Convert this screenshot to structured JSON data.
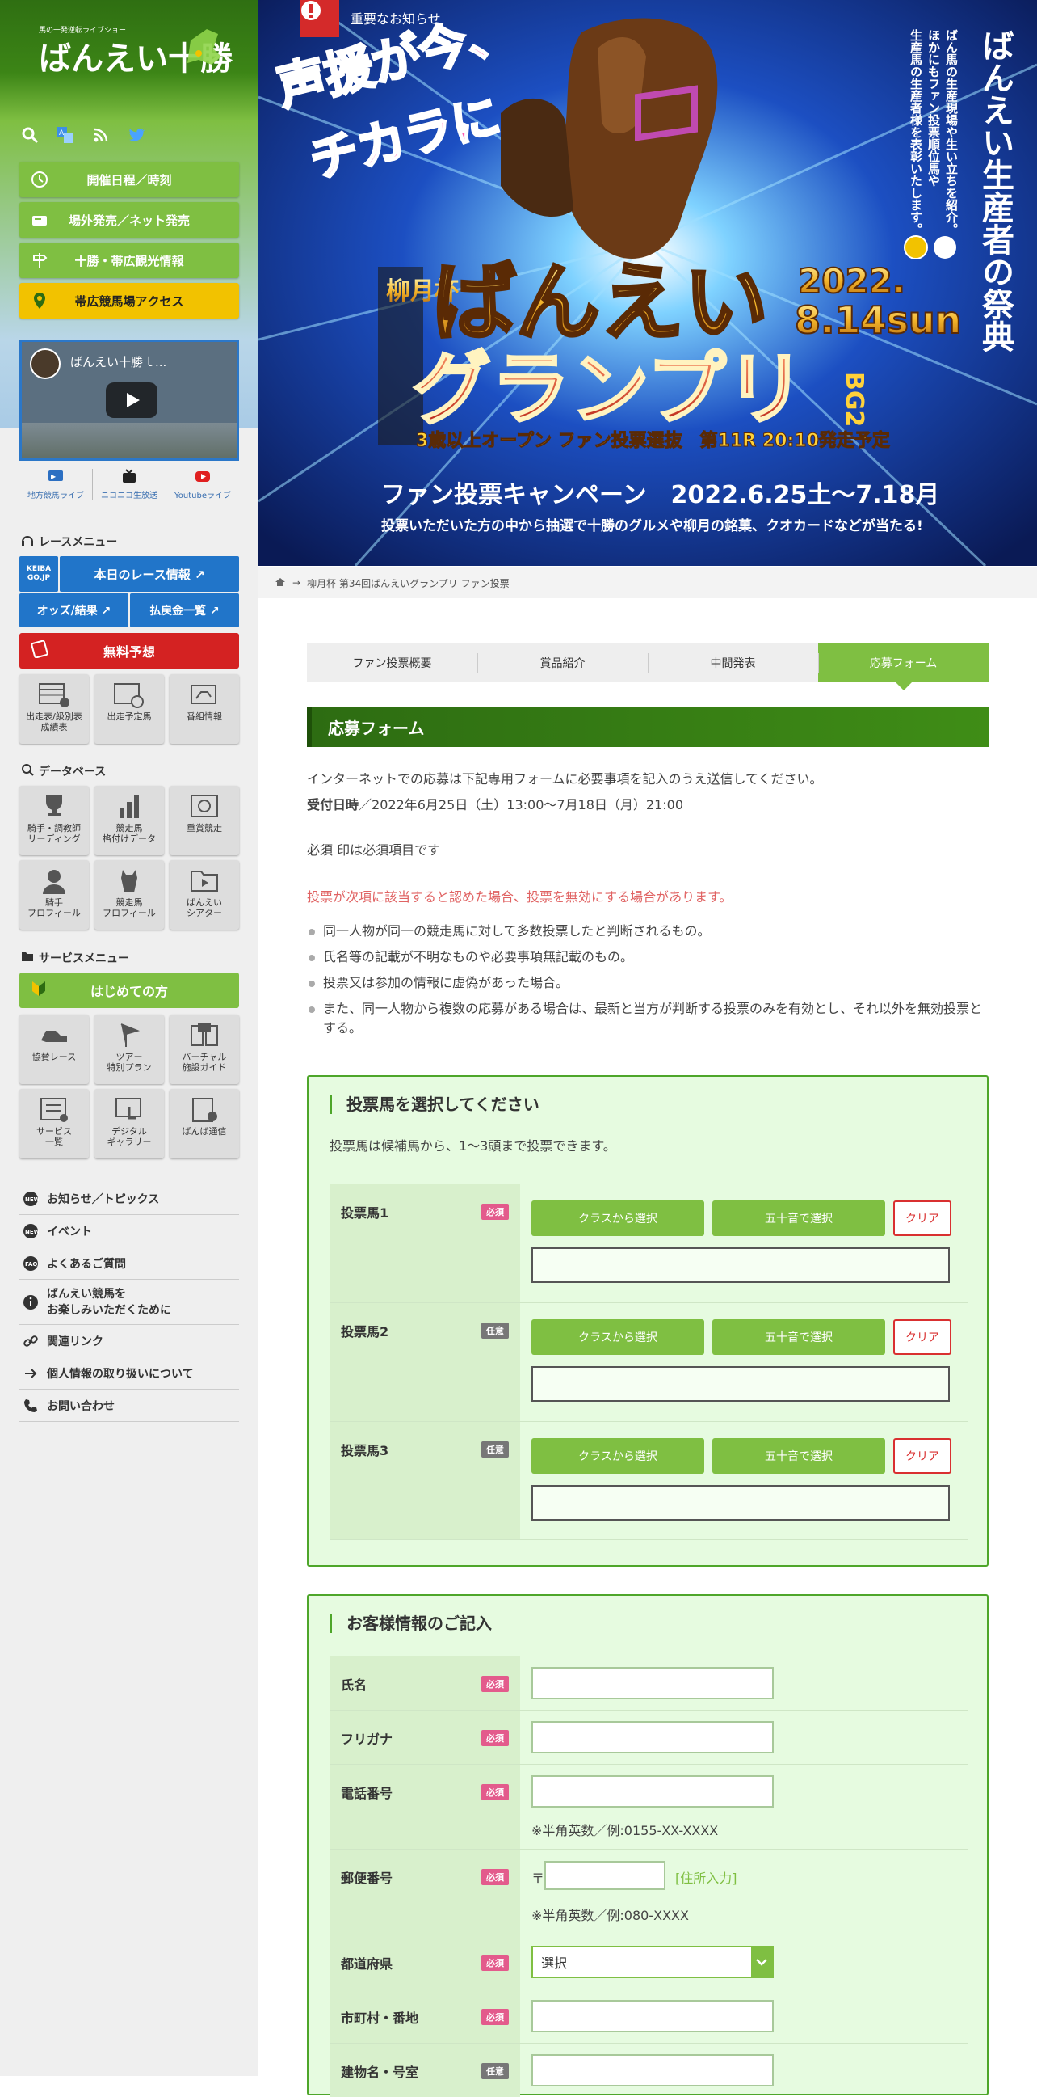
{
  "site": {
    "logo_text": "ばんえい十勝",
    "logo_sub": "馬の一発逆転ライブショー"
  },
  "sidebar": {
    "main_buttons": [
      {
        "label": "開催日程／時刻",
        "icon": "clock-icon"
      },
      {
        "label": "場外発売／ネット発売",
        "icon": "ticket-icon"
      },
      {
        "label": "十勝・帯広観光情報",
        "icon": "signpost-icon"
      },
      {
        "label": "帯広競馬場アクセス",
        "icon": "map-pin-icon"
      }
    ],
    "video": {
      "title": "ばんえい十勝ｌ..."
    },
    "live_links": [
      "地方競馬ライブ",
      "ニコニコ生放送",
      "Youtubeライブ"
    ],
    "race_menu": {
      "heading": "レースメニュー",
      "keiba_label": "KEIBA GO.JP",
      "today_race": "本日のレース情報 ↗",
      "odds": "オッズ/結果 ↗",
      "payout": "払戻金一覧 ↗",
      "free_prediction": "無料予想",
      "tiles": [
        "出走表/級別表\n成績表",
        "出走予定馬",
        "番組情報"
      ]
    },
    "database": {
      "heading": "データベース",
      "tiles": [
        "騎手・調教師\nリーディング",
        "競走馬\n格付けデータ",
        "重賞競走",
        "騎手\nプロフィール",
        "競走馬\nプロフィール",
        "ばんえい\nシアター"
      ]
    },
    "service_menu": {
      "heading": "サービスメニュー",
      "first_time": "はじめての方",
      "tiles": [
        "協賛レース",
        "ツアー\n特別プラン",
        "バーチャル\n施設ガイド",
        "サービス\n一覧",
        "デジタル\nギャラリー",
        "ばんば通信"
      ]
    },
    "links": [
      {
        "label": "お知らせ／トピックス",
        "icon": "new-icon"
      },
      {
        "label": "イベント",
        "icon": "new-icon"
      },
      {
        "label": "よくあるご質問",
        "icon": "faq-icon"
      },
      {
        "label": "ばんえい競馬を\nお楽しみいただくために",
        "icon": "info-icon"
      },
      {
        "label": "関連リンク",
        "icon": "link-icon"
      },
      {
        "label": "個人情報の取り扱いについて",
        "icon": "arrow-icon"
      },
      {
        "label": "お問い合わせ",
        "icon": "phone-icon"
      }
    ]
  },
  "hero": {
    "notice": "重要なお知らせ",
    "catch": "声援が今、\nチカラに",
    "right_title": "ばんえい生産者の祭典",
    "right_sub": "ばん馬の生産現場や生い立ちを紹介。\nほかにもファン投票順位馬や\n生産馬の生産者様を表彰いたします。",
    "cup_name": "柳月杯 第34回",
    "event_name": "ばんえいグランプリ",
    "grade": "BG2",
    "date": "2022.\n8.14sun",
    "race_info": "3歳以上オープン ファン投票選抜　第11R 20:10発走予定",
    "campaign": "ファン投票キャンペーン　2022.6.25土〜7.18月",
    "campaign_sub": "投票いただいた方の中から抽選で十勝のグルメや柳月の銘菓、クオカードなどが当たる!"
  },
  "breadcrumb": [
    "ホーム",
    "柳月杯 第34回ばんえいグランプリ ファン投票"
  ],
  "tabs": [
    "ファン投票概要",
    "賞品紹介",
    "中間発表",
    "応募フォーム"
  ],
  "form": {
    "title": "応募フォーム",
    "intro": "インターネットでの応募は下記専用フォームに必要事項を記入のうえ送信してください。",
    "period_label": "受付日時",
    "period": "／2022年6月25日（土）13:00～7月18日（月）21:00",
    "required_note": "必須 印は必須項目です",
    "warning": "投票が次項に該当すると認めた場合、投票を無効にする場合があります。",
    "rules": [
      "同一人物が同一の競走馬に対して多数投票したと判断されるもの。",
      "氏名等の記載が不明なものや必要事項無記載のもの。",
      "投票又は参加の情報に虚偽があった場合。",
      "また、同一人物から複数の応募がある場合は、最新と当方が判断する投票のみを有効とし、それ以外を無効投票とする。"
    ],
    "vote": {
      "heading": "投票馬を選択してください",
      "sub": "投票馬は候補馬から、1〜3頭まで投票できます。",
      "rows": [
        {
          "label": "投票馬1",
          "badge": "必須"
        },
        {
          "label": "投票馬2",
          "badge": "任意"
        },
        {
          "label": "投票馬3",
          "badge": "任意"
        }
      ],
      "class_btn": "クラスから選択",
      "kana_btn": "五十音で選択",
      "clear_btn": "クリア"
    },
    "customer": {
      "heading": "お客様情報のご記入",
      "rows": [
        {
          "label": "氏名",
          "badge": "必須"
        },
        {
          "label": "フリガナ",
          "badge": "必須"
        },
        {
          "label": "電話番号",
          "badge": "必須",
          "note": "※半角英数／例:0155-XX-XXXX"
        },
        {
          "label": "郵便番号",
          "badge": "必須",
          "prefix": "〒",
          "link": "[住所入力]",
          "note": "※半角英数／例:080-XXXX"
        },
        {
          "label": "都道府県",
          "badge": "必須",
          "select": "選択"
        },
        {
          "label": "市町村・番地",
          "badge": "必須"
        },
        {
          "label": "建物名・号室",
          "badge": "任意"
        }
      ]
    }
  }
}
